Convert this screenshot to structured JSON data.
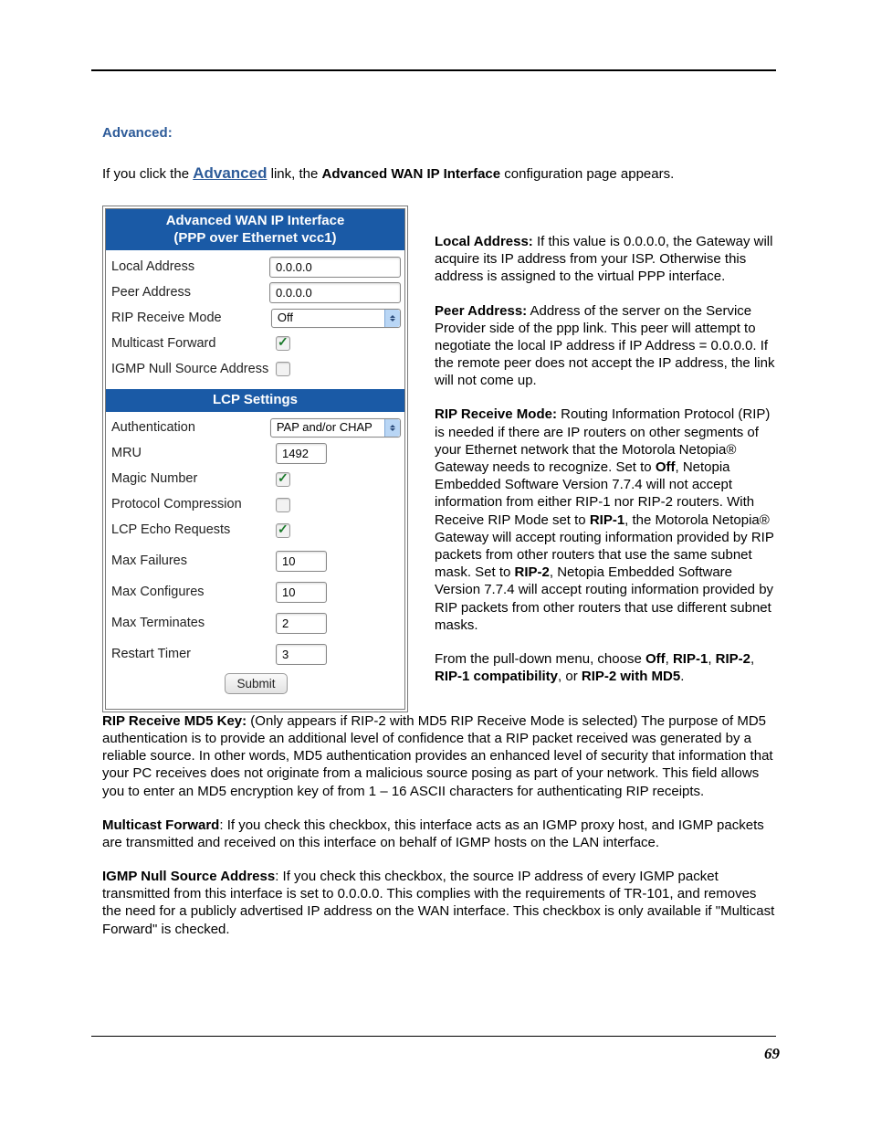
{
  "pageNumber": "69",
  "heading": "Advanced:",
  "intro": {
    "t1": "If you click the ",
    "link": "Advanced",
    "t2": " link, the ",
    "bold": "Advanced WAN IP Interface",
    "t3": " configuration page appears."
  },
  "panel": {
    "header1": "Advanced WAN IP Interface",
    "header2": "(PPP over Ethernet vcc1)",
    "lcpHeader": "LCP Settings",
    "labels": {
      "localAddress": "Local Address",
      "peerAddress": "Peer Address",
      "ripReceiveMode": "RIP Receive Mode",
      "multicastForward": "Multicast Forward",
      "igmpNull": "IGMP Null Source Address",
      "authentication": "Authentication",
      "mru": "MRU",
      "magicNumber": "Magic Number",
      "protocolCompression": "Protocol Compression",
      "lcpEcho": "LCP Echo Requests",
      "maxFailures": "Max Failures",
      "maxConfigures": "Max Configures",
      "maxTerminates": "Max Terminates",
      "restartTimer": "Restart Timer"
    },
    "values": {
      "localAddress": "0.0.0.0",
      "peerAddress": "0.0.0.0",
      "ripReceiveMode": "Off",
      "multicastForward": true,
      "igmpNull": false,
      "authentication": "PAP and/or CHAP",
      "mru": "1492",
      "magicNumber": true,
      "protocolCompression": false,
      "lcpEcho": true,
      "maxFailures": "10",
      "maxConfigures": "10",
      "maxTerminates": "2",
      "restartTimer": "3"
    },
    "submit": "Submit"
  },
  "desc": {
    "localAddress": {
      "label": "Local Address:",
      "text": " If this value is 0.0.0.0, the Gateway will acquire its IP address from your ISP. Otherwise this address is assigned to the virtual PPP interface."
    },
    "peerAddress": {
      "label": "Peer Address:",
      "text": " Address of the server on the Service Provider side of the ppp link. This peer will attempt to negotiate the local IP address if IP Address = 0.0.0.0. If the remote peer does not accept the IP address, the link will not come up."
    },
    "ripReceiveMode": {
      "label": "RIP Receive Mode:",
      "t1": " Routing Information Protocol (RIP) is needed if there are IP routers on other segments of your Ethernet network that the Motorola Netopia® Gateway needs to recognize. Set to ",
      "b1": "Off",
      "t2": ", Netopia Embedded Software Version 7.7.4 will not accept information from either RIP-1 nor RIP-2 routers. With Receive RIP Mode set to ",
      "b2": "RIP-1",
      "t3": ", the Motorola Netopia® Gateway will accept routing information provided by RIP packets from other routers that use the same subnet mask. Set to ",
      "b3": "RIP-2",
      "t4": ", Netopia Embedded Software Version 7.7.4 will accept routing information provided by RIP packets from other routers that use different subnet masks."
    },
    "pulldown": {
      "t1": "From the pull-down menu, choose ",
      "b1": "Off",
      "c1": ", ",
      "b2": "RIP-1",
      "c2": ", ",
      "b3": "RIP-2",
      "c3": ", ",
      "b4": "RIP-1 compatibility",
      "c4": ", or ",
      "b5": "RIP-2 with MD5",
      "c5": "."
    },
    "md5": {
      "label": "RIP Receive MD5 Key:",
      "text": " (Only appears if RIP-2 with MD5 RIP Receive Mode is selected) The purpose of MD5 authentication is to provide an additional level of confidence that a RIP packet received was generated by a reliable source. In other words, MD5 authentication provides an enhanced level of security that information that your PC receives does not originate from a malicious source posing as part of your network. This field allows you to enter an MD5 encryption key of from 1 – 16 ASCII characters for authenticating RIP receipts."
    },
    "multicast": {
      "label": "Multicast Forward",
      "text": ": If you check this checkbox, this interface acts as an IGMP proxy host, and IGMP packets are transmitted and received on this interface on behalf of IGMP hosts on the LAN interface."
    },
    "igmp": {
      "label": "IGMP Null Source Address",
      "text": ": If you check this checkbox, the source IP address of every IGMP packet transmitted from this interface is set to 0.0.0.0. This complies with the requirements of TR-101, and removes the need for a publicly advertised IP address on the WAN interface. This checkbox is only available if \"Multicast Forward\" is checked."
    }
  }
}
